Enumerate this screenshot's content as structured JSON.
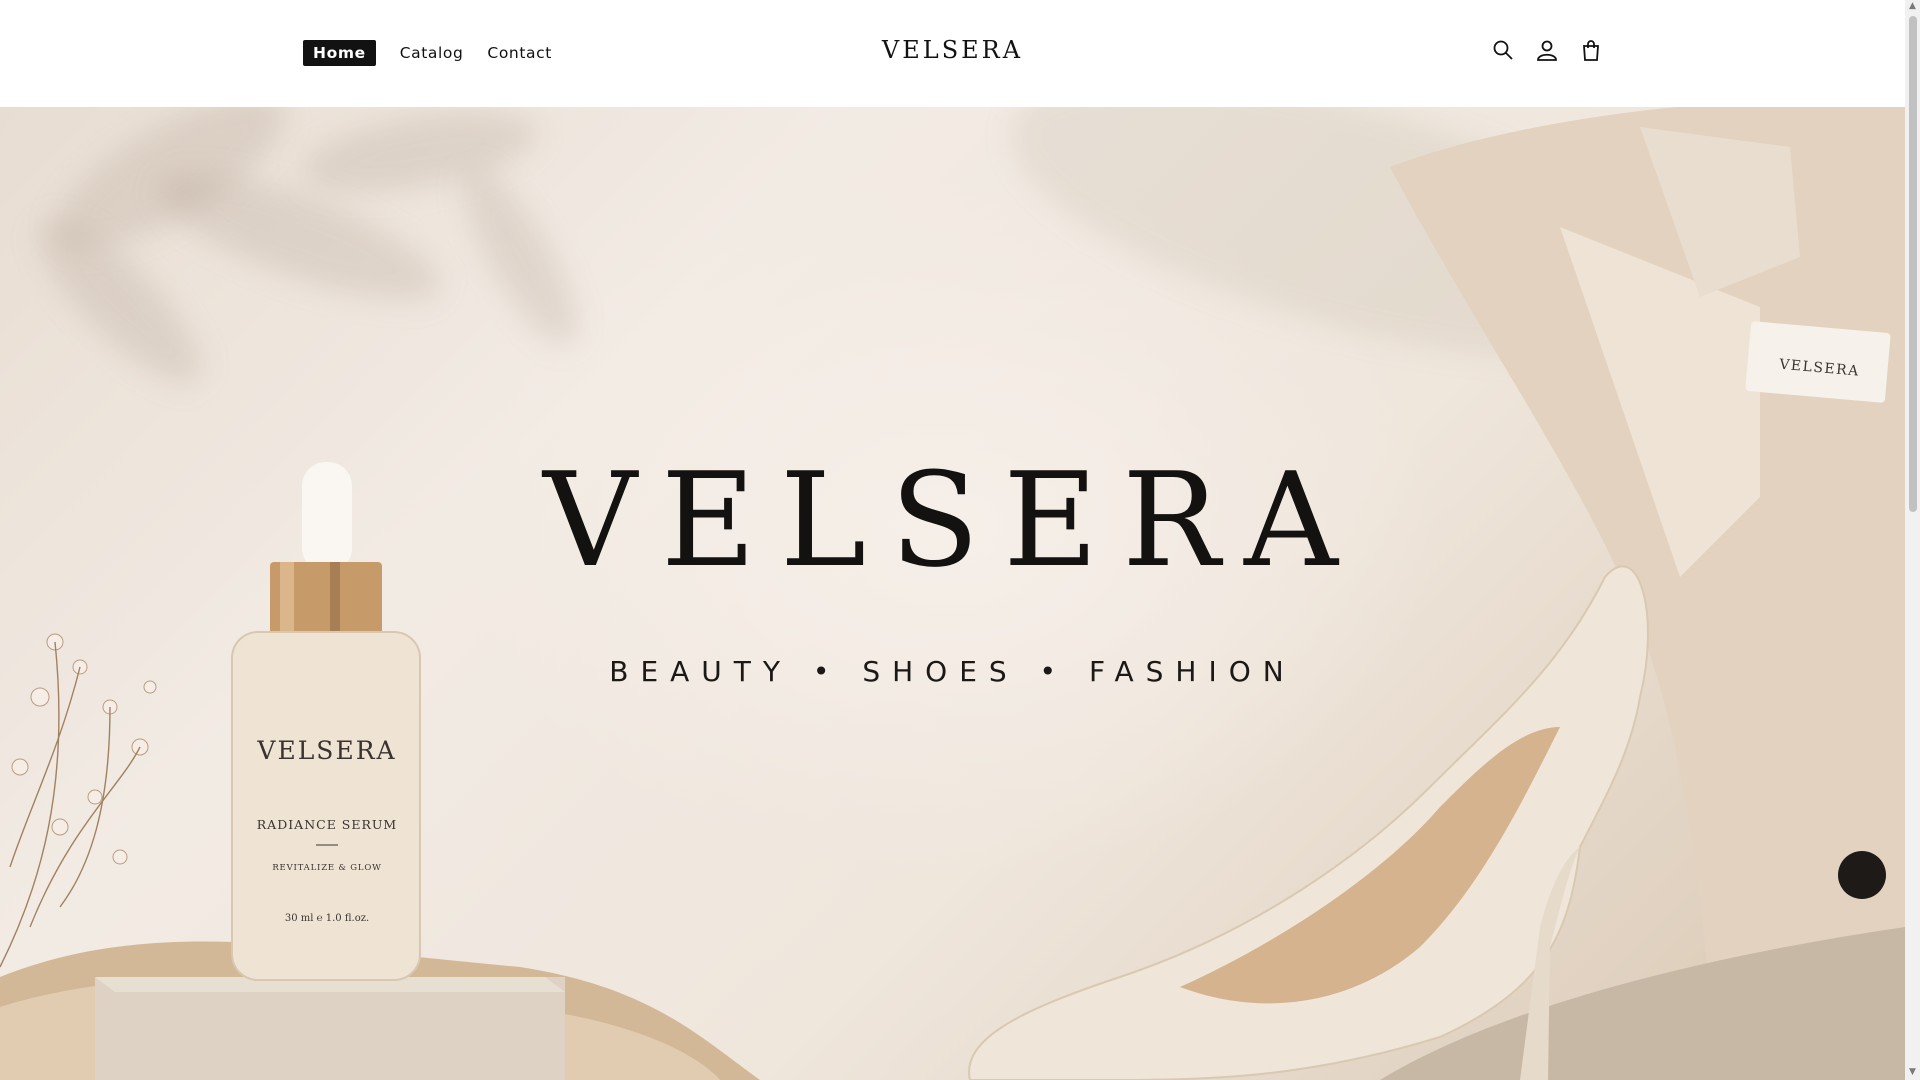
{
  "header": {
    "nav": [
      {
        "label": "Home",
        "active": true
      },
      {
        "label": "Catalog",
        "active": false
      },
      {
        "label": "Contact",
        "active": false
      }
    ],
    "logo": "VELSERA",
    "icons": [
      "search-icon",
      "account-icon",
      "cart-icon"
    ]
  },
  "hero": {
    "title": "VELSERA",
    "tagline": "BEAUTY • SHOES • FASHION",
    "serum": {
      "brand": "VELSERA",
      "name": "RADIANCE SERUM",
      "subtitle": "REVITALIZE & GLOW",
      "volume": "30 ml ℮ 1.0 fl.oz."
    },
    "jacket_tag": "VELSERA"
  },
  "colors": {
    "text": "#121212",
    "hero_bg": "#efe6dc",
    "active_nav_bg": "#121212"
  }
}
